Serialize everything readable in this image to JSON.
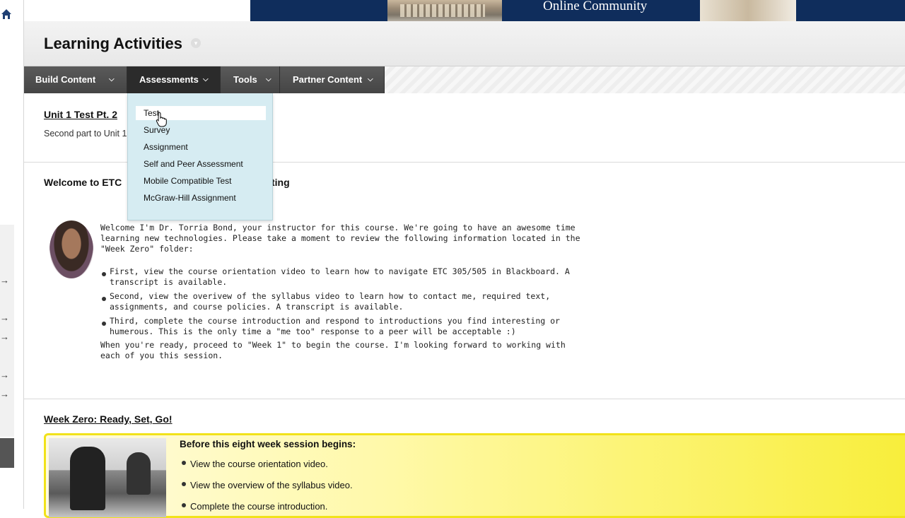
{
  "banner": {
    "title": "Online Community"
  },
  "header": {
    "title": "Learning Activities"
  },
  "action_bar": {
    "menus": [
      {
        "label": "Build Content"
      },
      {
        "label": "Assessments"
      },
      {
        "label": "Tools"
      },
      {
        "label": "Partner Content"
      }
    ]
  },
  "dropdown": {
    "items": [
      "Test",
      "Survey",
      "Assignment",
      "Self and Peer Assessment",
      "Mobile Compatible Test",
      "McGraw-Hill Assignment"
    ]
  },
  "content": {
    "unit_test": {
      "title": "Unit 1 Test Pt. 2",
      "desc": "Second part to Unit 1"
    },
    "welcome": {
      "title_left": "Welcome to ETC",
      "title_right": "ting",
      "intro": [
        "Welcome I'm Dr. Torria Bond, your instructor for this course. We're going to have an awesome time",
        "learning new technologies. Please take a moment to review the following information located in the",
        "\"Week Zero\" folder:"
      ],
      "bullets": [
        [
          "First, view the course orientation video to learn how to navigate ETC 305/505 in Blackboard. A",
          "transcript is available."
        ],
        [
          "Second, view the overivew of the syllabus video to learn how to contact me, required text,",
          "assignments, and course policies. A transcript is available."
        ],
        [
          "Third, complete the course introduction and respond to introductions you find interesting or",
          "humerous. This is the only time a \"me too\" response to a peer will be acceptable :)"
        ]
      ],
      "closing": [
        "When you're ready, proceed to \"Week 1\" to begin the course. I'm looking forward to working with",
        "each of you this session."
      ]
    },
    "week_zero": {
      "title": "Week Zero: Ready, Set, Go!",
      "heading": "Before this eight week session begins:",
      "bullets": [
        "View the course orientation video.",
        "View the overview of the syllabus video.",
        "Complete the course introduction."
      ]
    }
  }
}
